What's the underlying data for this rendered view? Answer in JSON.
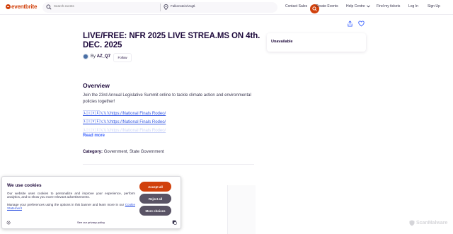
{
  "header": {
    "logo_text": "eventbrite",
    "search_placeholder": "Search events",
    "location_value": "Falkenstein/Vogtl.",
    "nav": [
      "Contact Sales",
      "Create Events",
      "Help Centre",
      "Find my tickets",
      "Log In",
      "Sign Up"
    ]
  },
  "event": {
    "title": "LIVE/FREE: NFR 2025 LIVE STREA.MS ON 4th. DEC. 2025",
    "by_prefix": "By",
    "organizer": "AZ_Q7",
    "follow_label": "Follow",
    "availability": "Unavailable"
  },
  "overview": {
    "heading": "Overview",
    "text": "Join the 23rd Annual Legislative Summit online to tackle climate action and environmental policies together!",
    "links": [
      "🄻🄸🅅🄴𝕏𝕏𝕏https://National Finals Rodeo/",
      "🄻🄸🅅🄴𝕏𝕏𝕏https://National Finals Rodeo/",
      "🄻🄸🅅🄴𝕏𝕏𝕏https://National Finals Rodeo/"
    ],
    "read_more": "Read more",
    "category_label": "Category:",
    "category_value": "Government, State Government"
  },
  "cookie": {
    "title": "We use cookies",
    "text1": "Our website uses cookies to personalize and improve your experience, perform analytics, and to show you more relevant advertisements.",
    "text2_prefix": "Manage your preferences using the options in this banner and learn more in our",
    "text2_link": "Cookie Statement",
    "accept_label": "Accept all",
    "reject_label": "Reject all",
    "more_label": "More choices",
    "privacy_label": "See our privacy policy"
  },
  "watermark": {
    "text": "ScanMalware"
  },
  "colors": {
    "brand": "#d1410c",
    "link": "#3659e3",
    "ink": "#1e0a3c",
    "button_gray": "#595365"
  }
}
